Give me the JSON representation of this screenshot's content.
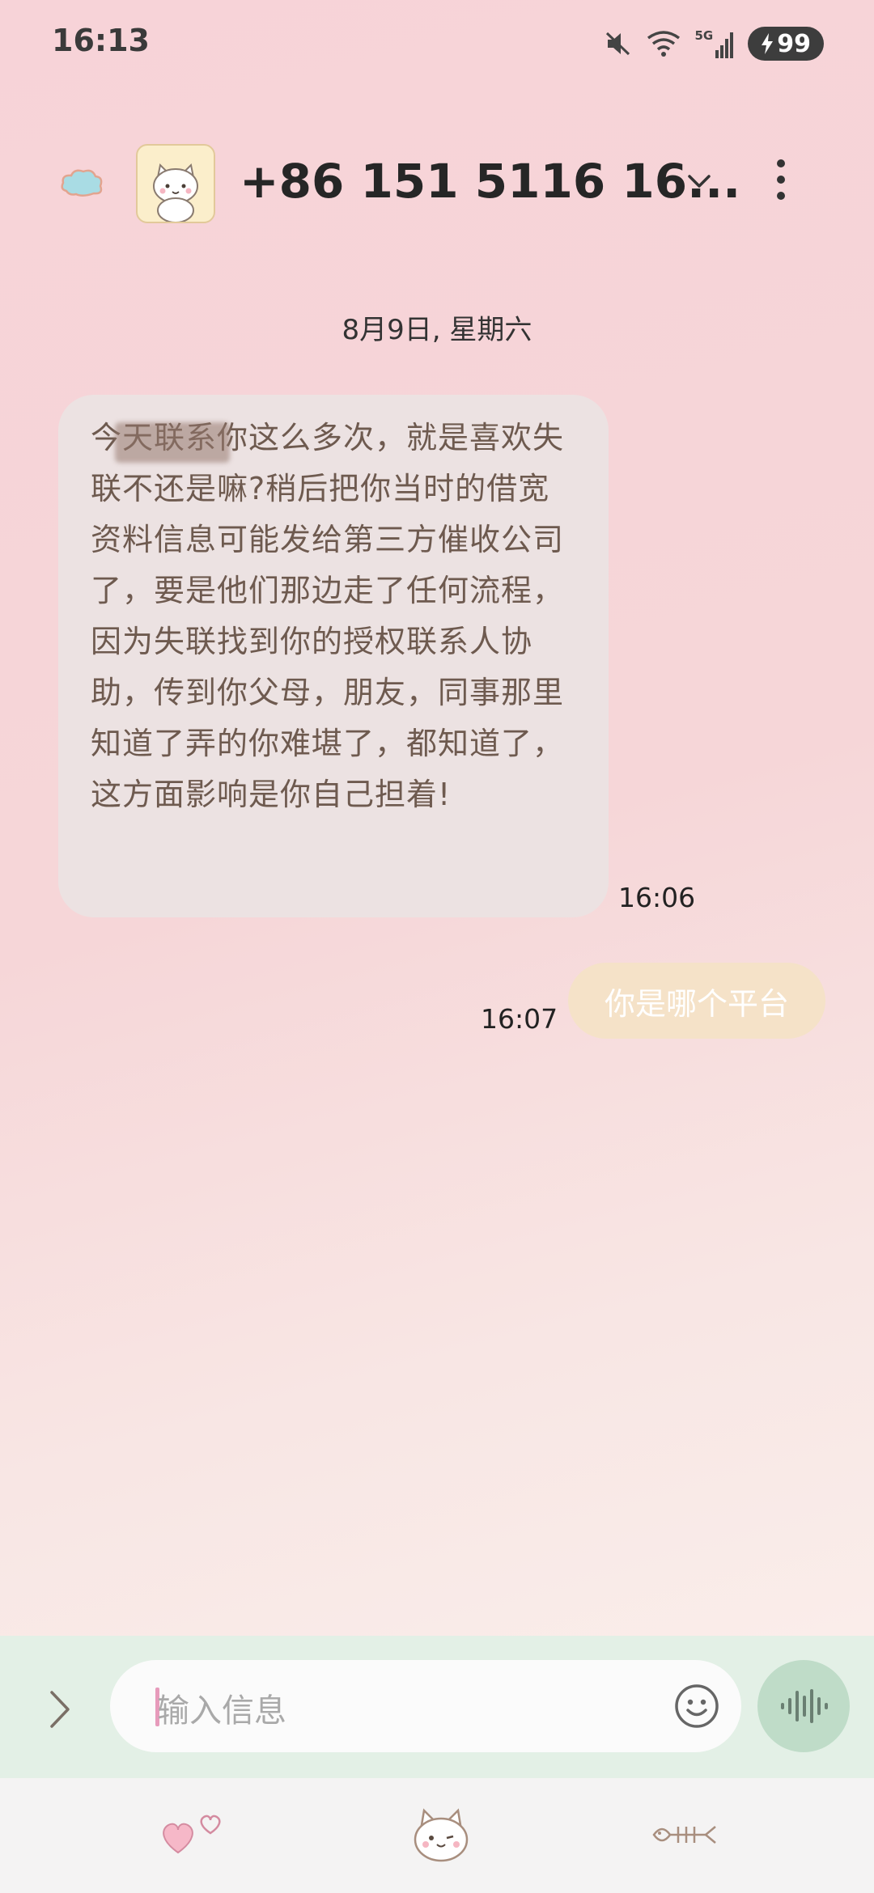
{
  "status_bar": {
    "time": "16:13",
    "network": "5G",
    "battery": "99"
  },
  "header": {
    "contact": "+86 151 5116 16..."
  },
  "conversation": {
    "date": "8月9日, 星期六",
    "incoming": {
      "text": "今天联系你这么多次，就是喜欢失联不还是嘛?稍后把你当时的借宽资料信息可能发给第三方催收公司了，要是他们那边走了任何流程，因为失联找到你的授权联系人协助，传到你父母，朋友，同事那里知道了弄的你难堪了，都知道了，这方面影响是你自己担着!",
      "time": "16:06"
    },
    "outgoing": {
      "text": "你是哪个平台",
      "time": "16:07"
    }
  },
  "composer": {
    "placeholder": "输入信息"
  },
  "icons": {
    "back": "cloud-back-icon",
    "avatar": "cat-avatar-icon",
    "dropdown": "chevron-down-icon",
    "more": "more-vertical-icon",
    "expand": "chevron-right-icon",
    "emoji": "smiley-icon",
    "voice": "soundwave-icon",
    "tab1": "hearts-icon",
    "tab2": "cat-face-icon",
    "tab3": "fish-bone-icon"
  },
  "colors": {
    "accent": "#e79bbb",
    "incoming_bubble": "#ece2e2",
    "outgoing_bubble": "#f5e2c8",
    "input_bar": "#e3f0e6"
  }
}
